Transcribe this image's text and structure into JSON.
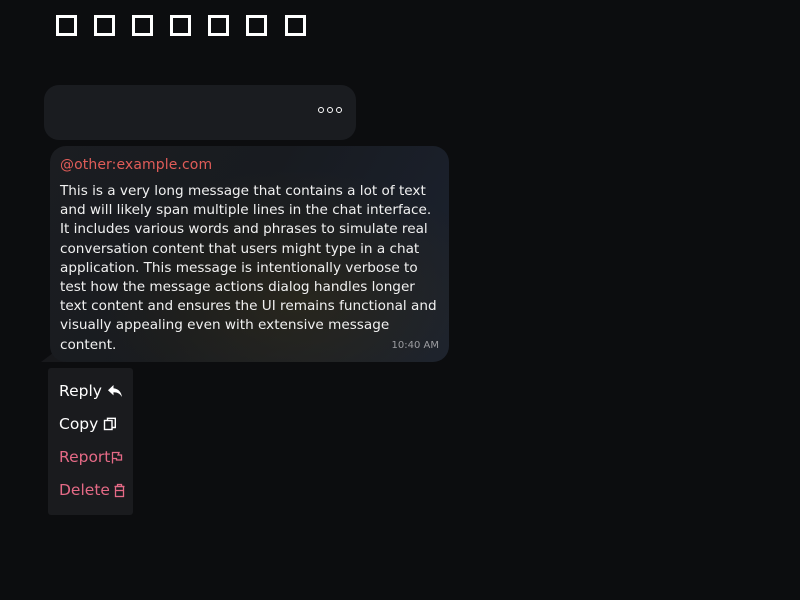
{
  "reactions": {
    "count": 7,
    "more_icon": "more-reactions-icon"
  },
  "message": {
    "sender": "@other:example.com",
    "body": "This is a very long message that contains a lot of text and will likely span multiple lines in the chat interface. It includes various words and phrases to simulate real conversation content that users might type in a chat application. This message is intentionally verbose to test how the message actions dialog handles longer text content and ensures the UI remains functional and visually appealing even with extensive message content.",
    "time": "10:40 AM"
  },
  "actions": [
    {
      "label": "Reply",
      "icon": "reply-icon",
      "color": "#ffffff"
    },
    {
      "label": "Copy",
      "icon": "copy-icon",
      "color": "#ffffff"
    },
    {
      "label": "Report",
      "icon": "flag-icon",
      "color": "#e56a86"
    },
    {
      "label": "Delete",
      "icon": "trash-icon",
      "color": "#e56a86"
    }
  ],
  "colors": {
    "background": "#0c0d0f",
    "sender": "#e05c58",
    "danger": "#e56a86"
  }
}
